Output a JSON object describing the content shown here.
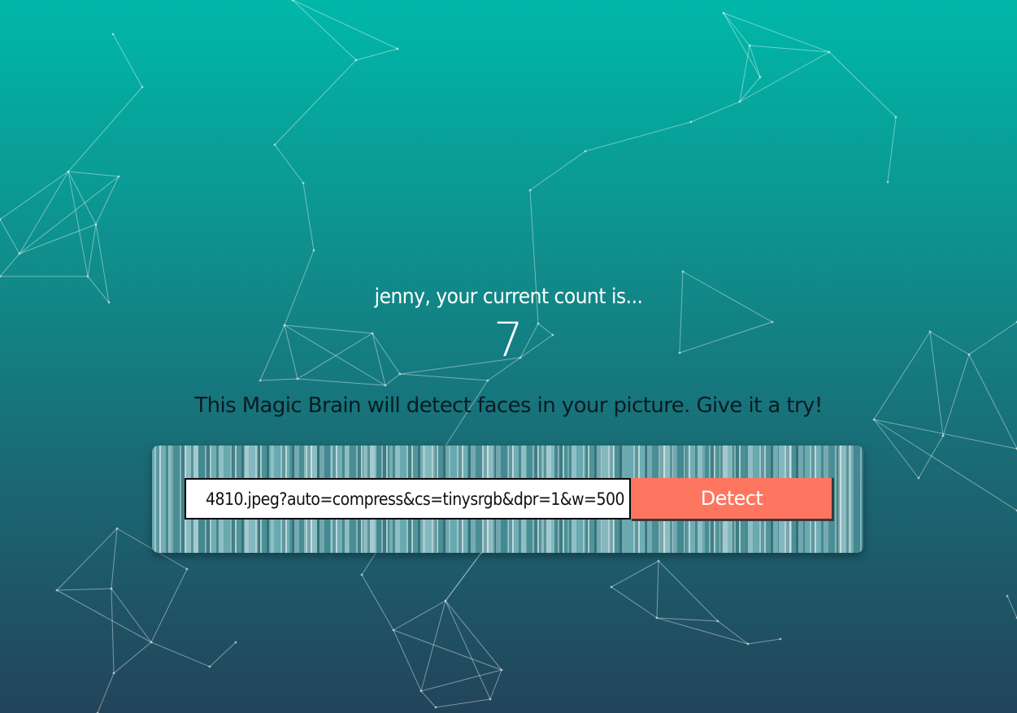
{
  "greeting": {
    "user_name": "jenny",
    "text": "jenny, your current count is..."
  },
  "count": {
    "value": "7"
  },
  "tagline": "This Magic Brain will detect faces in your picture. Give it a try!",
  "form": {
    "url_value": "4810.jpeg?auto=compress&cs=tinysrgb&dpr=1&w=500",
    "detect_label": "Detect"
  },
  "colors": {
    "background_top": "#00b8a9",
    "background_bottom": "#22445a",
    "button": "#ff7660",
    "text_light": "#ffffff",
    "text_dark": "#0b1b22"
  }
}
